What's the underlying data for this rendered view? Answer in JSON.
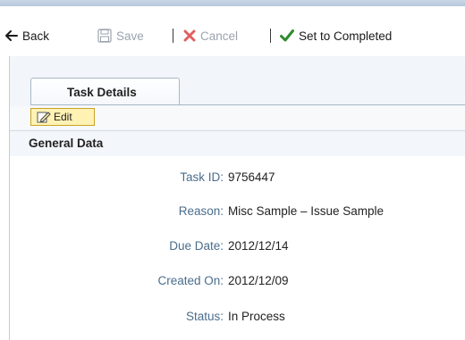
{
  "toolbar": {
    "back_label": "Back",
    "save_label": "Save",
    "cancel_label": "Cancel",
    "complete_label": "Set to Completed"
  },
  "tabs": [
    {
      "label": "Task Details",
      "selected": true
    }
  ],
  "actions": {
    "edit_label": "Edit"
  },
  "section": {
    "title": "General Data"
  },
  "fields": [
    {
      "label": "Task ID:",
      "value": "9756447"
    },
    {
      "label": "Reason:",
      "value": "Misc Sample – Issue Sample"
    },
    {
      "label": "Due Date:",
      "value": "2012/12/14"
    },
    {
      "label": "Created On:",
      "value": "2012/12/09"
    },
    {
      "label": "Status:",
      "value": "In Process"
    }
  ],
  "colors": {
    "label_blue": "#4a6d8c",
    "edit_highlight": "#fff2b3",
    "cancel_red": "#d9534f",
    "complete_green": "#2e8b2e"
  }
}
